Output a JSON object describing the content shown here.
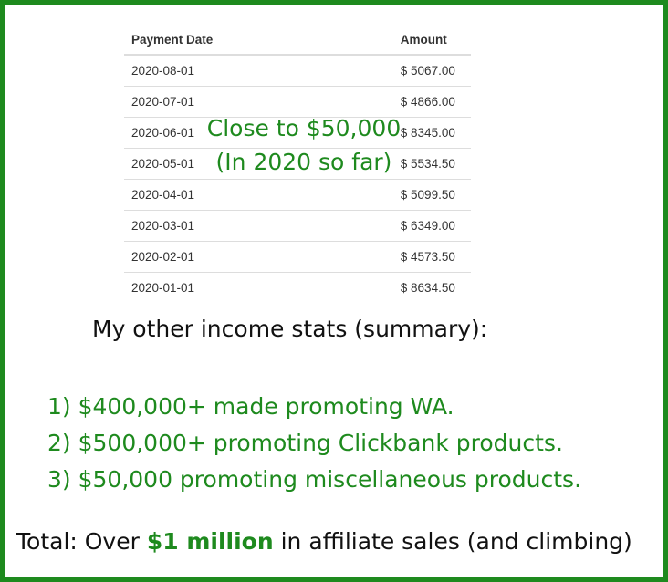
{
  "colors": {
    "border": "#1e8a1e",
    "accent_green": "#1e8a1e",
    "text": "#111111",
    "table_text": "#333333",
    "table_rule": "#dddddd"
  },
  "table": {
    "headers": {
      "date": "Payment Date",
      "amount": "Amount"
    },
    "rows": [
      {
        "date": "2020-08-01",
        "amount": "$ 5067.00"
      },
      {
        "date": "2020-07-01",
        "amount": "$ 4866.00"
      },
      {
        "date": "2020-06-01",
        "amount": "$ 8345.00"
      },
      {
        "date": "2020-05-01",
        "amount": "$ 5534.50"
      },
      {
        "date": "2020-04-01",
        "amount": "$ 5099.50"
      },
      {
        "date": "2020-03-01",
        "amount": "$ 6349.00"
      },
      {
        "date": "2020-02-01",
        "amount": "$ 4573.50"
      },
      {
        "date": "2020-01-01",
        "amount": "$ 8634.50"
      }
    ]
  },
  "overlay": {
    "line1": "Close to $50,000",
    "line2": "(In 2020 so far)"
  },
  "summary": {
    "heading": "My other income stats (summary):",
    "items": [
      "1) $400,000+ made promoting WA.",
      "2) $500,000+ promoting Clickbank products.",
      "3) $50,000 promoting miscellaneous products."
    ]
  },
  "total": {
    "prefix": "Total: Over ",
    "highlight": "$1 million",
    "suffix": " in affiliate sales (and climbing)"
  }
}
